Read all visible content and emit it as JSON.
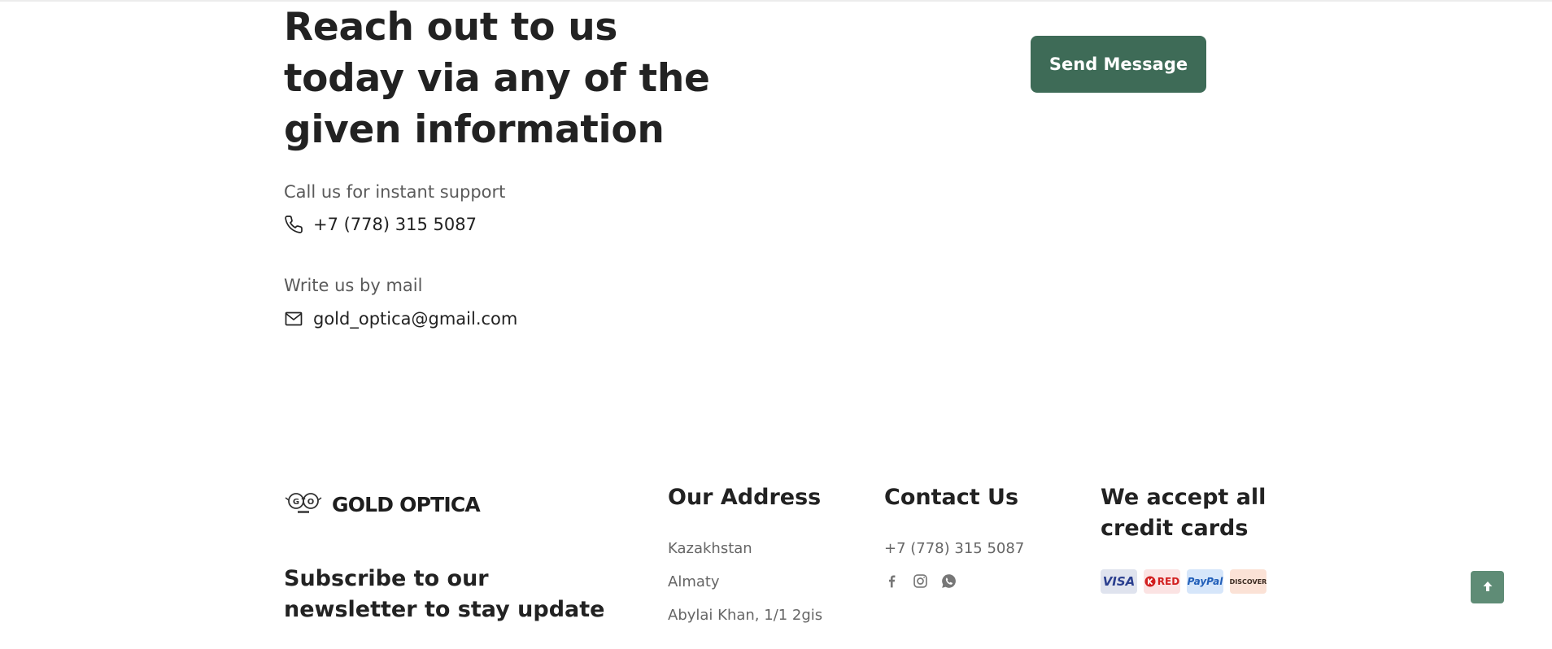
{
  "contact_section": {
    "heading": "Reach out to us today via any of the given information",
    "send_button_label": "Send Message",
    "phone_label": "Call us for instant support",
    "phone_value": "+7 (778) 315 5087",
    "mail_label": "Write us by mail",
    "mail_value": "gold_optica@gmail.com",
    "icons": [
      "phone-icon",
      "mail-icon"
    ]
  },
  "footer": {
    "brand": {
      "name": "GOLD OPTICA",
      "logo_glyph": "GO"
    },
    "newsletter_title": "Subscribe to our newsletter to stay update",
    "address": {
      "title": "Our Address",
      "lines": [
        "Kazakhstan",
        "Almaty",
        "Abylai Khan, 1/1 2gis"
      ]
    },
    "contact": {
      "title": "Contact Us",
      "phone": "+7 (778) 315 5087",
      "social_icons": [
        "facebook-icon",
        "instagram-icon",
        "whatsapp-icon"
      ]
    },
    "payments": {
      "title": "We accept all credit cards",
      "cards": [
        "VISA",
        "RED",
        "PayPal",
        "DISCOVER"
      ]
    }
  },
  "back_to_top": {
    "icon": "arrow-up-icon"
  },
  "colors": {
    "accent": "#3e6b57",
    "back_to_top": "#5f8c76",
    "text_dark": "#222222",
    "text_muted": "#666666"
  }
}
